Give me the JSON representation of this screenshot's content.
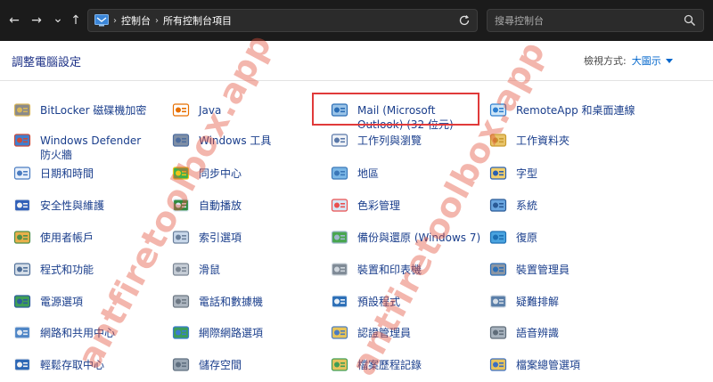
{
  "toolbar": {
    "back_glyph": "←",
    "forward_glyph": "→",
    "recent_glyph": "⌄",
    "up_glyph": "↑"
  },
  "address": {
    "crumbs": [
      "控制台",
      "所有控制台項目"
    ]
  },
  "search": {
    "placeholder": "搜尋控制台"
  },
  "header": {
    "title": "調整電腦設定",
    "view_by_label": "檢視方式:",
    "view_by_value": "大圖示"
  },
  "items": [
    {
      "label": "BitLocker 磁碟機加密",
      "icon": "bitlocker-icon"
    },
    {
      "label": "Java",
      "icon": "java-icon"
    },
    {
      "label": "Mail (Microsoft Outlook) (32 位元)",
      "icon": "mail-icon"
    },
    {
      "label": "RemoteApp 和桌面連線",
      "icon": "remoteapp-icon"
    },
    {
      "label": "Windows Defender 防火牆",
      "icon": "firewall-icon"
    },
    {
      "label": "Windows 工具",
      "icon": "windows-tools-icon"
    },
    {
      "label": "工作列與瀏覽",
      "icon": "taskbar-icon"
    },
    {
      "label": "工作資料夾",
      "icon": "work-folders-icon"
    },
    {
      "label": "日期和時間",
      "icon": "date-time-icon"
    },
    {
      "label": "同步中心",
      "icon": "sync-center-icon"
    },
    {
      "label": "地區",
      "icon": "region-icon"
    },
    {
      "label": "字型",
      "icon": "fonts-icon"
    },
    {
      "label": "安全性與維護",
      "icon": "security-maintenance-icon"
    },
    {
      "label": "自動播放",
      "icon": "autoplay-icon"
    },
    {
      "label": "色彩管理",
      "icon": "color-management-icon"
    },
    {
      "label": "系統",
      "icon": "system-icon"
    },
    {
      "label": "使用者帳戶",
      "icon": "user-accounts-icon"
    },
    {
      "label": "索引選項",
      "icon": "indexing-options-icon"
    },
    {
      "label": "備份與還原 (Windows 7)",
      "icon": "backup-restore-icon"
    },
    {
      "label": "復原",
      "icon": "recovery-icon"
    },
    {
      "label": "程式和功能",
      "icon": "programs-features-icon"
    },
    {
      "label": "滑鼠",
      "icon": "mouse-icon"
    },
    {
      "label": "裝置和印表機",
      "icon": "devices-printers-icon"
    },
    {
      "label": "裝置管理員",
      "icon": "device-manager-icon"
    },
    {
      "label": "電源選項",
      "icon": "power-options-icon"
    },
    {
      "label": "電話和數據機",
      "icon": "phone-modem-icon"
    },
    {
      "label": "預設程式",
      "icon": "default-programs-icon"
    },
    {
      "label": "疑難排解",
      "icon": "troubleshooting-icon"
    },
    {
      "label": "網路和共用中心",
      "icon": "network-sharing-icon"
    },
    {
      "label": "網際網路選項",
      "icon": "internet-options-icon"
    },
    {
      "label": "認證管理員",
      "icon": "credential-manager-icon"
    },
    {
      "label": "語音辨識",
      "icon": "speech-recognition-icon"
    },
    {
      "label": "輕鬆存取中心",
      "icon": "ease-of-access-icon"
    },
    {
      "label": "儲存空間",
      "icon": "storage-spaces-icon"
    },
    {
      "label": "檔案歷程記錄",
      "icon": "file-history-icon"
    },
    {
      "label": "檔案總管選項",
      "icon": "file-explorer-options-icon"
    }
  ],
  "watermark": "antfiretoolbox.app",
  "colors": {
    "topbar": "#1b1b1b",
    "link": "#1a3e8c",
    "highlight_box": "#e03a3a",
    "watermark": "#e2503c"
  }
}
